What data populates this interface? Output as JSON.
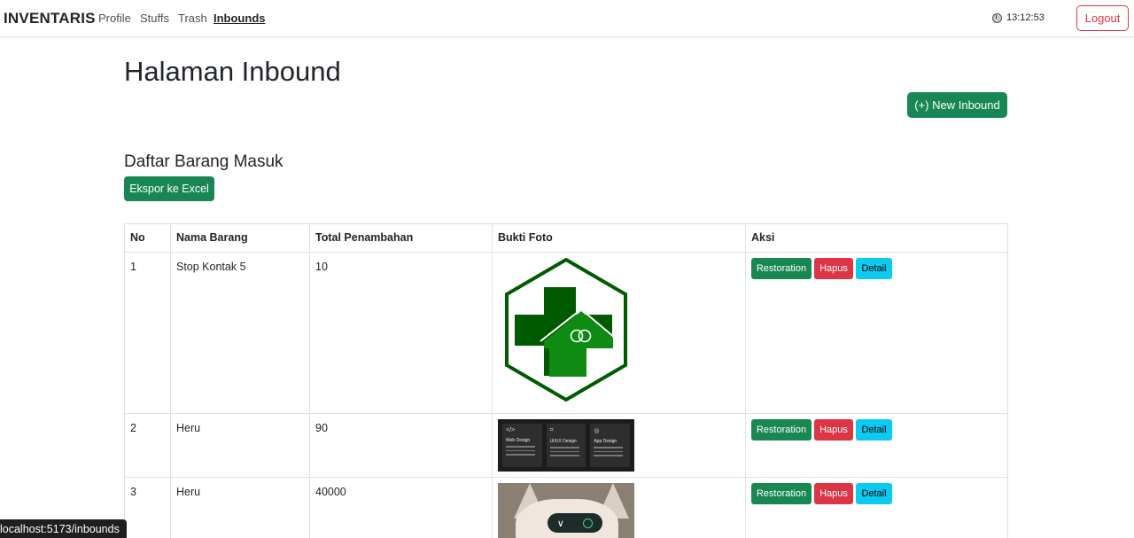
{
  "nav": {
    "brand": "INVENTARIS",
    "links": [
      "Profile",
      "Stuffs",
      "Trash",
      "Inbounds"
    ],
    "active": "Inbounds",
    "clock": "13:12:53",
    "logout": "Logout"
  },
  "page": {
    "title": "Halaman Inbound",
    "new_button": "(+) New Inbound",
    "section_title": "Daftar Barang Masuk",
    "export_button": "Ekspor ke Excel"
  },
  "table": {
    "headers": [
      "No",
      "Nama Barang",
      "Total Penambahan",
      "Bukti Foto",
      "Aksi"
    ],
    "rows": [
      {
        "no": "1",
        "nama": "Stop Kontak 5",
        "total": "10"
      },
      {
        "no": "2",
        "nama": "Heru",
        "total": "90"
      },
      {
        "no": "3",
        "nama": "Heru",
        "total": "40000"
      }
    ],
    "actions": {
      "restore": "Restoration",
      "delete": "Hapus",
      "detail": "Detail"
    }
  },
  "thumb2": {
    "cards": [
      {
        "icon": "</>",
        "title": "Web Design"
      },
      {
        "icon": "⌗",
        "title": "Ui/UX Design"
      },
      {
        "icon": "◎",
        "title": "App Design"
      }
    ]
  },
  "colors": {
    "success": "#198754",
    "danger": "#dc3545",
    "info": "#0dcaf0",
    "logo_dark": "#005a00",
    "logo_light": "#0f8a13"
  },
  "status_url": "localhost:5173/inbounds"
}
